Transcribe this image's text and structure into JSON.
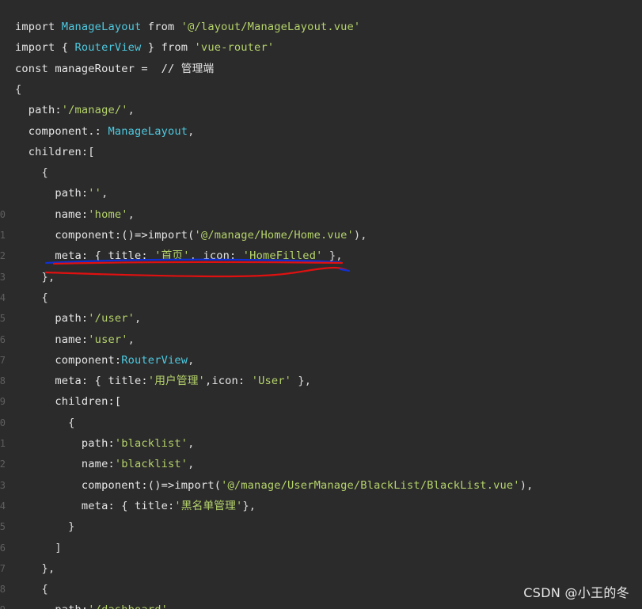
{
  "lines": [
    [
      {
        "t": "import ",
        "c": "kw"
      },
      {
        "t": "ManageLayout",
        "c": "ty"
      },
      {
        "t": " from ",
        "c": "kw"
      },
      {
        "t": "'@/layout/ManageLayout.vue'",
        "c": "str"
      }
    ],
    [
      {
        "t": "import { ",
        "c": "kw"
      },
      {
        "t": "RouterView",
        "c": "ty"
      },
      {
        "t": " } from ",
        "c": "kw"
      },
      {
        "t": "'vue-router'",
        "c": "str"
      }
    ],
    [
      {
        "t": "const manageRouter =  // 管理端",
        "c": "kw"
      }
    ],
    [
      {
        "t": "{",
        "c": "pn"
      }
    ],
    [
      {
        "t": "  path:",
        "c": "id"
      },
      {
        "t": "'/manage/'",
        "c": "str"
      },
      {
        "t": ",",
        "c": "pn"
      }
    ],
    [
      {
        "t": "  component.: ",
        "c": "id"
      },
      {
        "t": "ManageLayout",
        "c": "ty"
      },
      {
        "t": ",",
        "c": "pn"
      }
    ],
    [
      {
        "t": "  children:[",
        "c": "id"
      }
    ],
    [
      {
        "t": "    {",
        "c": "pn"
      }
    ],
    [
      {
        "t": "      path:",
        "c": "id"
      },
      {
        "t": "''",
        "c": "str"
      },
      {
        "t": ",",
        "c": "pn"
      }
    ],
    [
      {
        "t": "      name:",
        "c": "id"
      },
      {
        "t": "'home'",
        "c": "str"
      },
      {
        "t": ",",
        "c": "pn"
      }
    ],
    [
      {
        "t": "      component:()=>import(",
        "c": "id"
      },
      {
        "t": "'@/manage/Home/Home.vue'",
        "c": "str"
      },
      {
        "t": "),",
        "c": "pn"
      }
    ],
    [
      {
        "t": "      meta: { title: ",
        "c": "id"
      },
      {
        "t": "'首页'",
        "c": "str"
      },
      {
        "t": ", icon: ",
        "c": "id"
      },
      {
        "t": "'HomeFilled'",
        "c": "str"
      },
      {
        "t": " },",
        "c": "pn"
      }
    ],
    [
      {
        "t": "    },",
        "c": "pn"
      }
    ],
    [
      {
        "t": "    {",
        "c": "pn"
      }
    ],
    [
      {
        "t": "      path:",
        "c": "id"
      },
      {
        "t": "'/user'",
        "c": "str"
      },
      {
        "t": ",",
        "c": "pn"
      }
    ],
    [
      {
        "t": "      name:",
        "c": "id"
      },
      {
        "t": "'user'",
        "c": "str"
      },
      {
        "t": ",",
        "c": "pn"
      }
    ],
    [
      {
        "t": "      component:",
        "c": "id"
      },
      {
        "t": "RouterView",
        "c": "ty"
      },
      {
        "t": ",",
        "c": "pn"
      }
    ],
    [
      {
        "t": "      meta: { title:",
        "c": "id"
      },
      {
        "t": "'用户管理'",
        "c": "str"
      },
      {
        "t": ",icon: ",
        "c": "id"
      },
      {
        "t": "'User'",
        "c": "str"
      },
      {
        "t": " },",
        "c": "pn"
      }
    ],
    [
      {
        "t": "      children:[",
        "c": "id"
      }
    ],
    [
      {
        "t": "        {",
        "c": "pn"
      }
    ],
    [
      {
        "t": "          path:",
        "c": "id"
      },
      {
        "t": "'blacklist'",
        "c": "str"
      },
      {
        "t": ",",
        "c": "pn"
      }
    ],
    [
      {
        "t": "          name:",
        "c": "id"
      },
      {
        "t": "'blacklist'",
        "c": "str"
      },
      {
        "t": ",",
        "c": "pn"
      }
    ],
    [
      {
        "t": "          component:()=>import(",
        "c": "id"
      },
      {
        "t": "'@/manage/UserManage/BlackList/BlackList.vue'",
        "c": "str"
      },
      {
        "t": "),",
        "c": "pn"
      }
    ],
    [
      {
        "t": "          meta: { title:",
        "c": "id"
      },
      {
        "t": "'黑名单管理'",
        "c": "str"
      },
      {
        "t": "},",
        "c": "pn"
      }
    ],
    [
      {
        "t": "        }",
        "c": "pn"
      }
    ],
    [
      {
        "t": "      ]",
        "c": "pn"
      }
    ],
    [
      {
        "t": "    },",
        "c": "pn"
      }
    ],
    [
      {
        "t": "    {",
        "c": "pn"
      }
    ],
    [
      {
        "t": "      path:",
        "c": "id"
      },
      {
        "t": "'/dashboard'",
        "c": "str"
      },
      {
        "t": ",",
        "c": "pn"
      }
    ]
  ],
  "gutter_numbers": [
    "",
    "",
    "",
    "",
    "",
    "",
    "",
    "",
    "",
    "0",
    "1",
    "2",
    "3",
    "4",
    "5",
    "6",
    "7",
    "8",
    "9",
    "0",
    "1",
    "2",
    "3",
    "4",
    "5",
    "6",
    "7",
    "8",
    "9"
  ],
  "watermark": "CSDN @小王的冬",
  "colors": {
    "background": "#2b2b2b",
    "type": "#4ec9e0",
    "string": "#b5d36b",
    "text": "#e6e6e6",
    "annotation_red": "#e01010",
    "annotation_blue": "#1030d0"
  }
}
